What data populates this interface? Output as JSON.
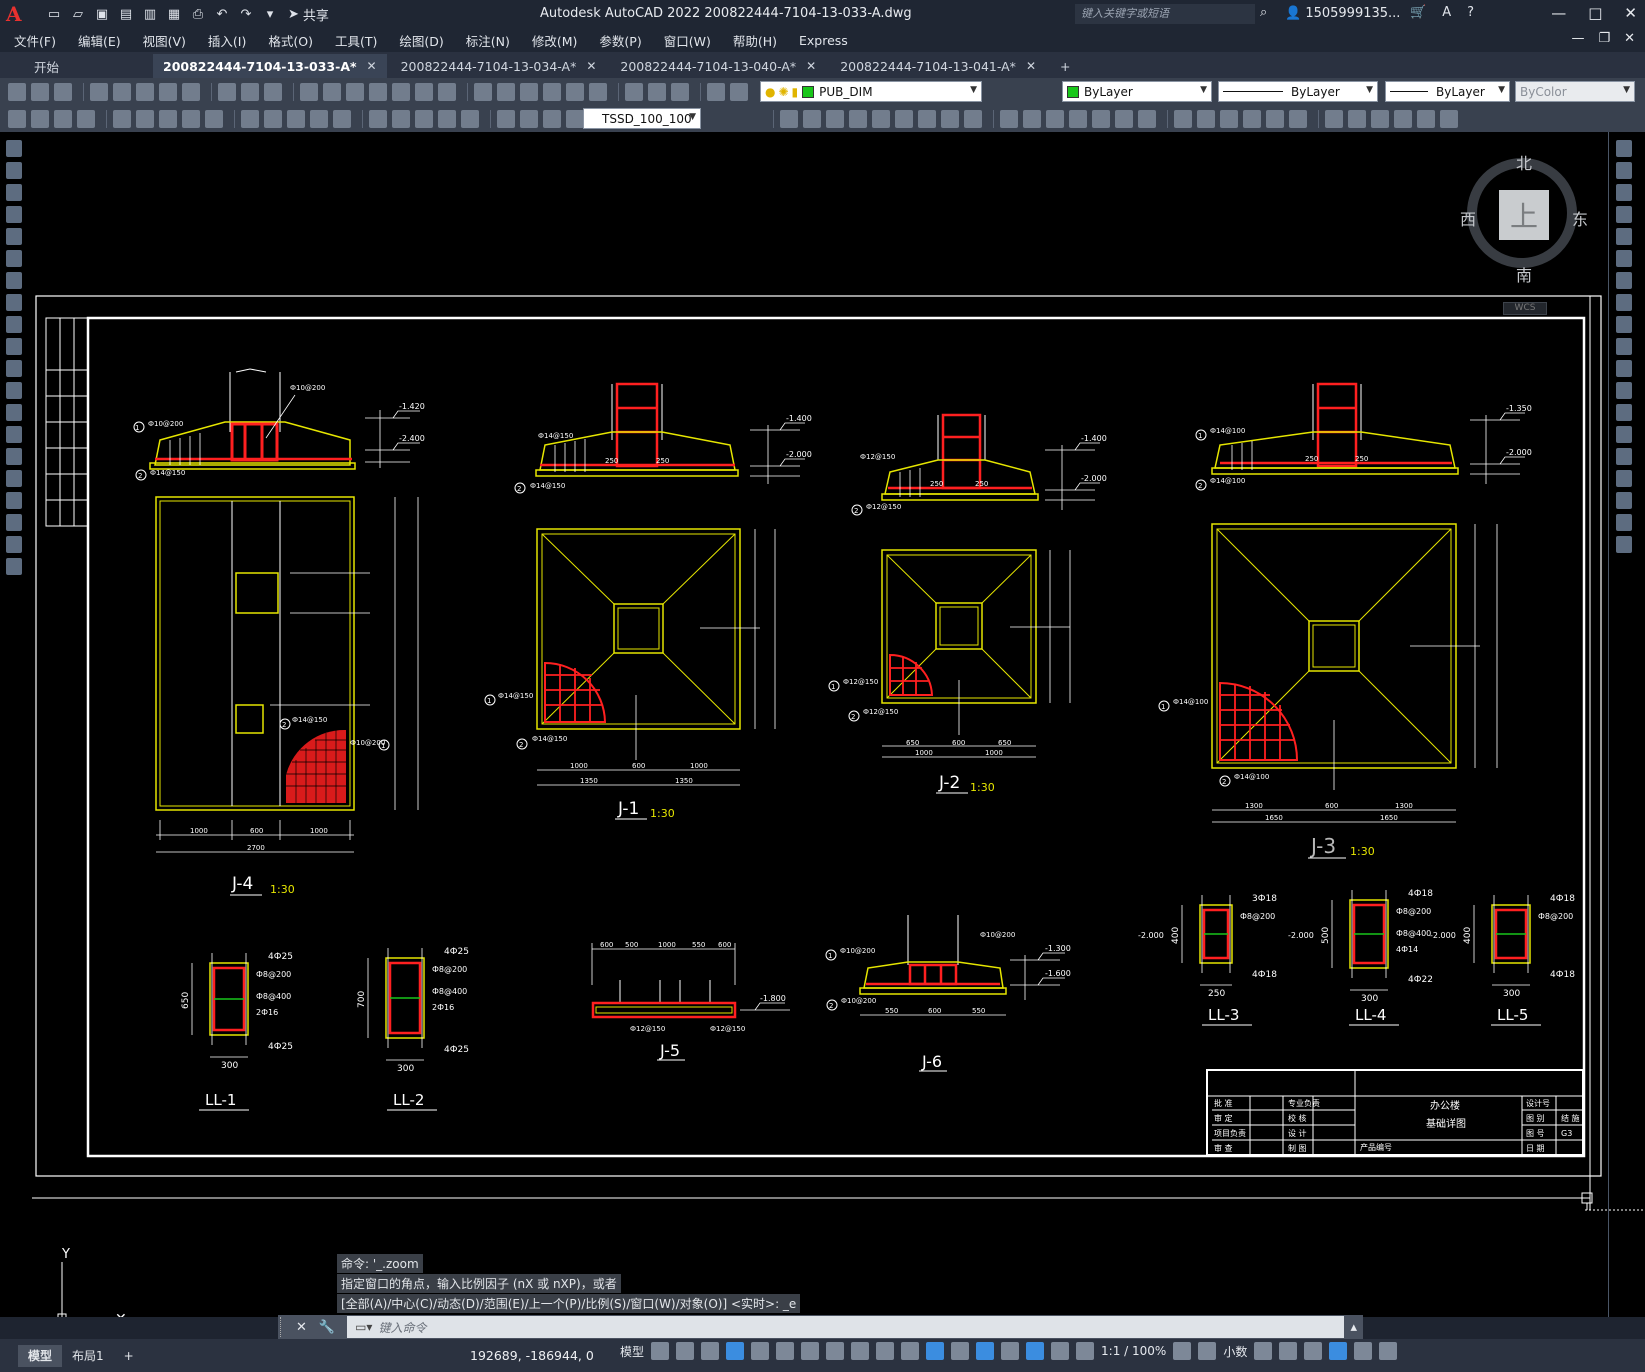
{
  "app": {
    "logo": "A",
    "title": "Autodesk AutoCAD 2022    200822444-7104-13-033-A.dwg",
    "share_label": "共享",
    "search_placeholder": "键入关键字或短语",
    "user": "1505999135...",
    "help": "?"
  },
  "menu": [
    "文件(F)",
    "编辑(E)",
    "视图(V)",
    "插入(I)",
    "格式(O)",
    "工具(T)",
    "绘图(D)",
    "标注(N)",
    "修改(M)",
    "参数(P)",
    "窗口(W)",
    "帮助(H)",
    "Express"
  ],
  "tabs": {
    "start": "开始",
    "docs": [
      "200822444-7104-13-033-A*",
      "200822444-7104-13-034-A*",
      "200822444-7104-13-040-A*",
      "200822444-7104-13-041-A*"
    ]
  },
  "toolbar": {
    "layer": "PUB_DIM",
    "color": "ByLayer",
    "linetype": "ByLayer",
    "lineweight": "ByLayer",
    "plotstyle": "ByColor",
    "dimstyle": "TSSD_100_100",
    "layer_color": "#19c61a"
  },
  "viewcube": {
    "top": "上",
    "north": "北",
    "south": "南",
    "east": "东",
    "west": "西",
    "wcs": "WCS"
  },
  "drawing": {
    "footings": [
      {
        "id": "J-4",
        "scale": "1:30"
      },
      {
        "id": "J-1",
        "scale": "1:30"
      },
      {
        "id": "J-2",
        "scale": "1:30"
      },
      {
        "id": "J-3",
        "scale": "1:30"
      },
      {
        "id": "J-5",
        "scale": ""
      },
      {
        "id": "J-6",
        "scale": ""
      }
    ],
    "beams": [
      {
        "id": "LL-1",
        "top": "4Ф25",
        "stir": "Ф8@200",
        "waist": "Ф8@400",
        "mid": "2Ф16",
        "bot": "4Ф25",
        "w": "300",
        "h": "650"
      },
      {
        "id": "LL-2",
        "top": "4Ф25",
        "stir": "Ф8@200",
        "waist": "Ф8@400",
        "mid": "2Ф16",
        "bot": "4Ф25",
        "w": "300",
        "h": "700"
      },
      {
        "id": "LL-3",
        "top": "3Ф18",
        "stir": "Ф8@200",
        "bot": "4Ф18",
        "w": "250",
        "h": "400",
        "elev": "-2.000"
      },
      {
        "id": "LL-4",
        "top": "4Ф18",
        "stir": "Ф8@200",
        "waist": "Ф8@400",
        "mid": "4Ф14",
        "bot": "4Ф22",
        "w": "300",
        "h": "500",
        "elev": "-2.000"
      },
      {
        "id": "LL-5",
        "top": "4Ф18",
        "stir": "Ф8@200",
        "bot": "4Ф18",
        "w": "300",
        "h": "400",
        "elev": "-2.000"
      }
    ],
    "dims": {
      "j4_bottom": [
        "100",
        "1000",
        "100",
        "600",
        "100",
        "1000",
        "100"
      ],
      "j4_total": "2700",
      "j1_bottom": [
        "100",
        "1000",
        "50",
        "600",
        "50",
        "1000",
        "100"
      ],
      "j1_half": [
        "1350",
        "1350"
      ],
      "j2_bottom": [
        "100",
        "650",
        "100",
        "600",
        "100",
        "650",
        "100"
      ],
      "j2_half": [
        "1000",
        "1000"
      ],
      "j3_bottom": [
        "100",
        "1300",
        "50",
        "600",
        "50",
        "1300",
        "100"
      ],
      "j3_half": [
        "1650",
        "1650"
      ],
      "j5_top": [
        "600",
        "500",
        "1000",
        "550",
        "600"
      ],
      "j6_bottom": [
        "100",
        "550",
        "100",
        "600",
        "100",
        "550",
        "100"
      ],
      "rebar_a": "Ф14@150",
      "rebar_b": "Ф10@200",
      "rebar_c": "Ф14@100",
      "rebar_d": "Ф12@150",
      "rebar_e": "Ф12@150",
      "elev_j1": [
        "-1.400",
        "-2.000"
      ],
      "elev_j2": [
        "-1.400",
        "-2.000"
      ],
      "elev_j3": [
        "-1.350",
        "-2.000"
      ],
      "elev_j4": [
        "-1.420",
        "-2.400"
      ],
      "elev_j6": [
        "-1.300",
        "-1.600"
      ],
      "elev_j5": "-1.800"
    },
    "titleblock": {
      "project": "办公楼",
      "drawing": "基础详图",
      "rows_left": [
        "批 准",
        "审 定",
        "项目负责",
        "审 查"
      ],
      "rows_mid": [
        "专业负责",
        "校 核",
        "设 计",
        "制 图"
      ],
      "rows_right": [
        "设计号",
        "图 别",
        "图 号",
        "日 期"
      ],
      "values_right": [
        "",
        "结 施",
        "G3",
        ""
      ],
      "product": "产品编号"
    }
  },
  "command": {
    "history": [
      "命令: '_.zoom",
      "指定窗口的角点，输入比例因子 (nX 或 nXP)，或者",
      "[全部(A)/中心(C)/动态(D)/范围(E)/上一个(P)/比例(S)/窗口(W)/对象(O)] <实时>: _e"
    ],
    "placeholder": "键入命令"
  },
  "status": {
    "layouts": [
      "模型",
      "布局1"
    ],
    "coords": "192689, -186944, 0",
    "space": "模型",
    "scale": "1:1 / 100%",
    "units": "小数"
  }
}
